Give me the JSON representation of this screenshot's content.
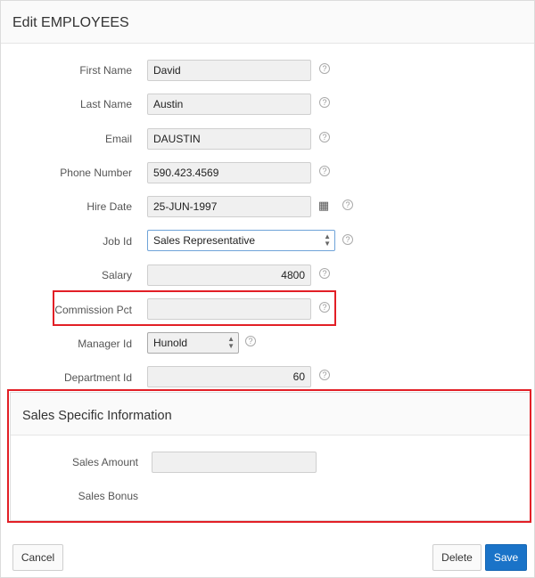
{
  "region": {
    "title": "Edit EMPLOYEES"
  },
  "form": {
    "first_name": {
      "label": "First Name",
      "value": "David"
    },
    "last_name": {
      "label": "Last Name",
      "value": "Austin"
    },
    "email": {
      "label": "Email",
      "value": "DAUSTIN"
    },
    "phone": {
      "label": "Phone Number",
      "value": "590.423.4569"
    },
    "hire_date": {
      "label": "Hire Date",
      "value": "25-JUN-1997"
    },
    "job_id": {
      "label": "Job Id",
      "value": "Sales Representative"
    },
    "salary": {
      "label": "Salary",
      "value": "4800"
    },
    "commission": {
      "label": "Commission Pct",
      "value": ""
    },
    "manager_id": {
      "label": "Manager Id",
      "value": "Hunold"
    },
    "department_id": {
      "label": "Department Id",
      "value": "60"
    }
  },
  "sales": {
    "title": "Sales Specific Information",
    "amount": {
      "label": "Sales Amount",
      "value": ""
    },
    "bonus": {
      "label": "Sales Bonus"
    }
  },
  "buttons": {
    "cancel": "Cancel",
    "delete": "Delete",
    "save": "Save"
  },
  "icons": {
    "help": "help-circle-icon",
    "calendar": "calendar-icon",
    "select": "select-arrows-icon"
  },
  "colors": {
    "highlight": "#e21f26",
    "primary": "#1a73c8"
  }
}
